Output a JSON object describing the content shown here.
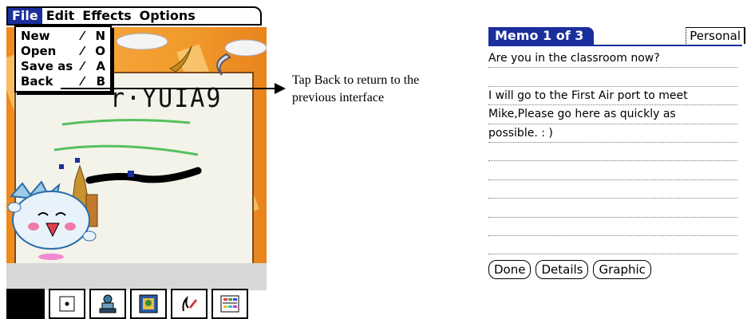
{
  "menubar": {
    "items": [
      {
        "label": "File"
      },
      {
        "label": "Edit"
      },
      {
        "label": "Effects"
      },
      {
        "label": "Options"
      }
    ]
  },
  "file_menu": {
    "items": [
      {
        "label": "New",
        "shortcut_key": "N"
      },
      {
        "label": "Open",
        "shortcut_key": "O"
      },
      {
        "label": "Save as",
        "shortcut_key": "A"
      },
      {
        "label": "Back",
        "shortcut_key": "B"
      }
    ]
  },
  "drawing": {
    "handwriting": "r·YUIA9"
  },
  "toolbar": {
    "tools": [
      {
        "icon": "color-swatch-icon"
      },
      {
        "icon": "brush-size-icon"
      },
      {
        "icon": "stamp-icon"
      },
      {
        "icon": "background-icon"
      },
      {
        "icon": "pen-icon"
      },
      {
        "icon": "palette-icon"
      }
    ]
  },
  "callout": {
    "text": "Tap Back to return to the previous interface"
  },
  "memo": {
    "title": "Memo 1 of 3",
    "category": "Personal",
    "lines": [
      "Are  you in the classroom now?",
      "",
      "I will go to the First Air port  to meet",
      "Mike,Please go here as quickly as",
      "possible. : )",
      "",
      "",
      "",
      "",
      "",
      ""
    ],
    "buttons": {
      "done": "Done",
      "details": "Details",
      "graphic": "Graphic"
    }
  },
  "colors": {
    "palm_blue": "#1a2e9c",
    "orange_bg": "#f08a1c"
  }
}
